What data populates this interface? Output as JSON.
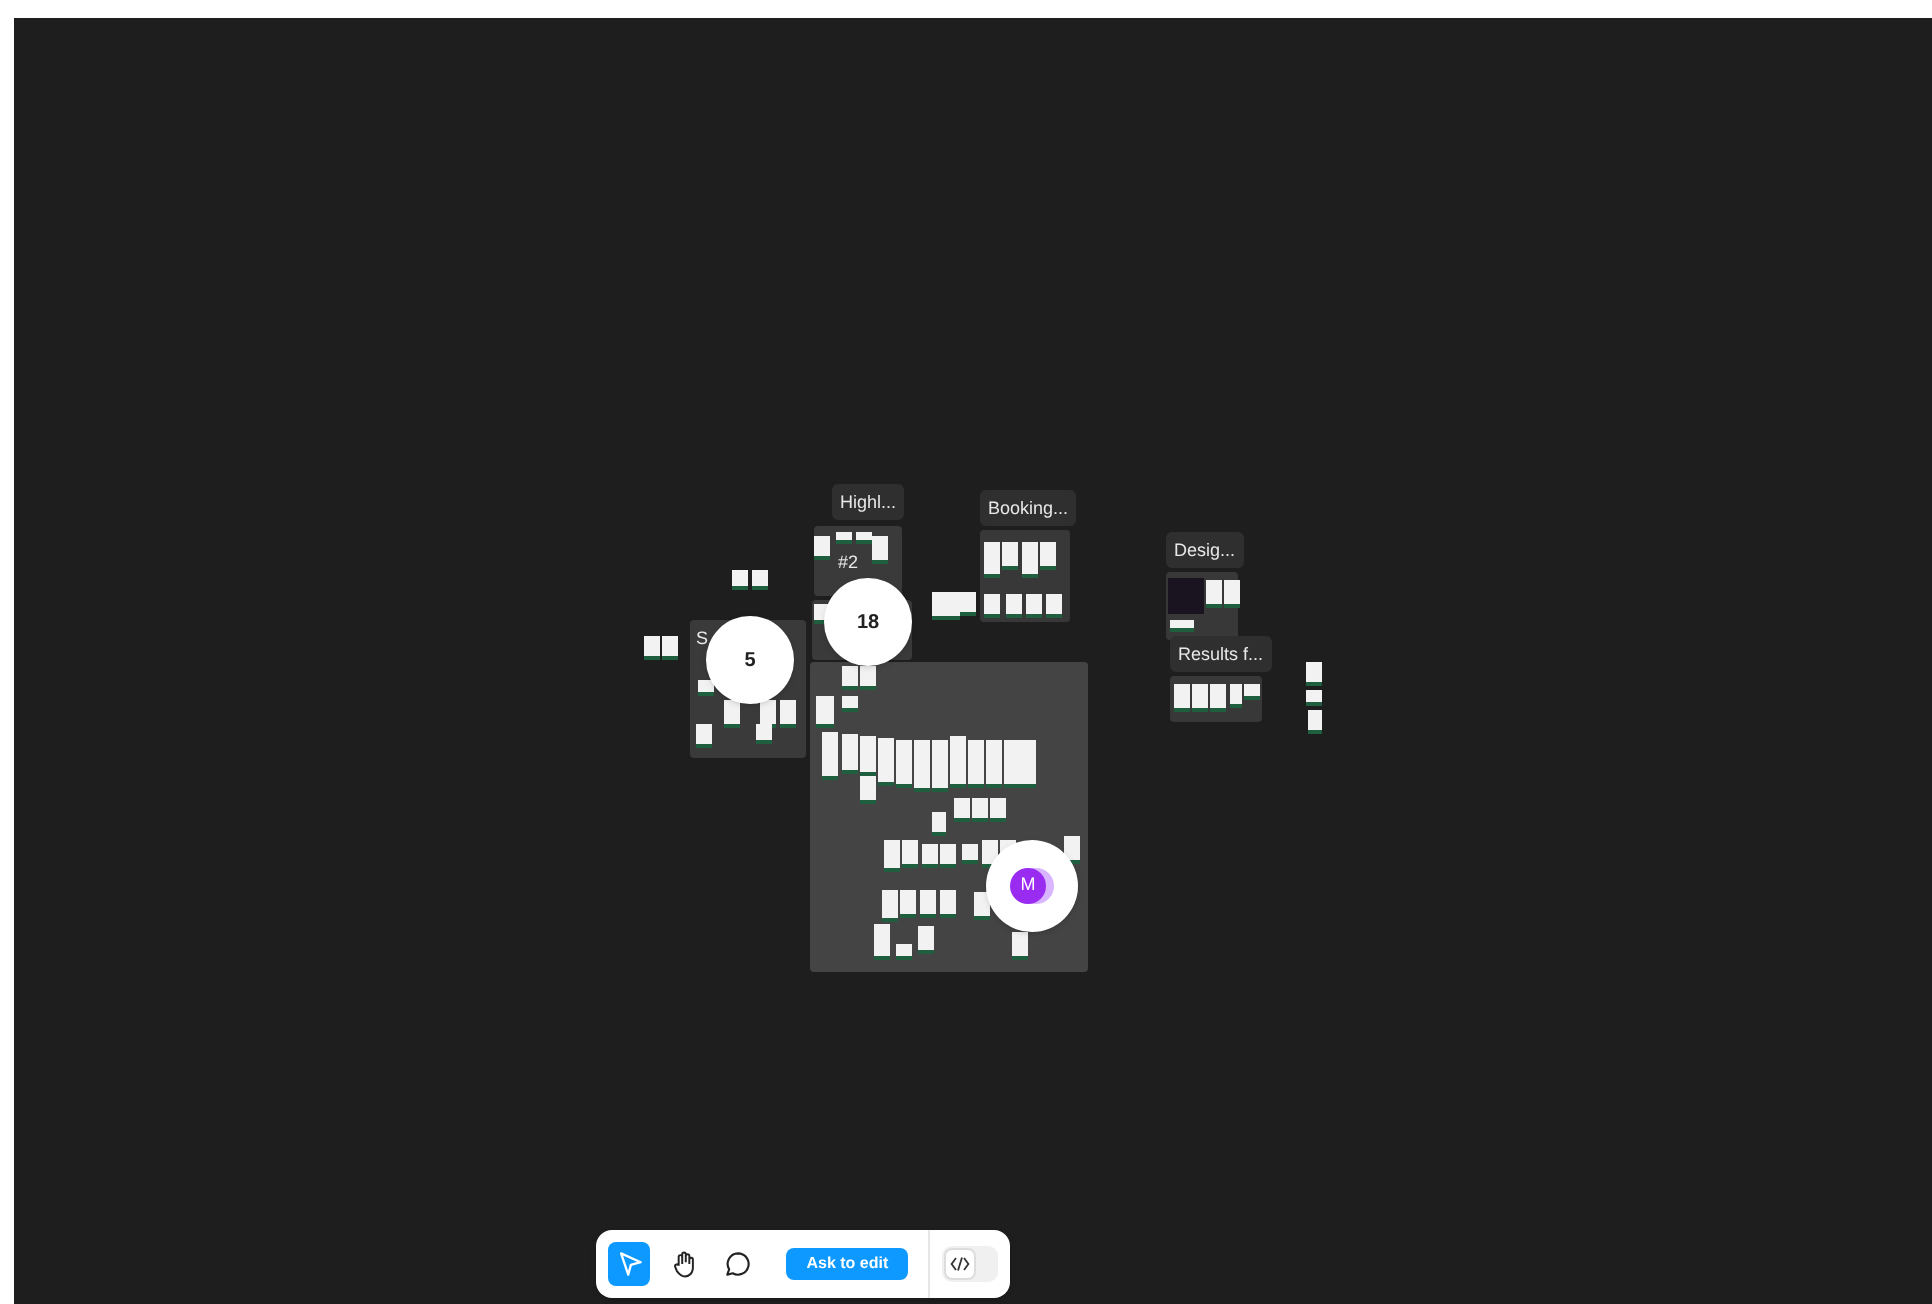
{
  "sections": [
    {
      "label": "Highl..."
    },
    {
      "label": "#2"
    },
    {
      "label": "Booking..."
    },
    {
      "label": "Desig..."
    },
    {
      "label": "Results f..."
    },
    {
      "label": "S"
    }
  ],
  "clusters": [
    {
      "count": "5"
    },
    {
      "count": "18"
    }
  ],
  "collaborator": {
    "initial": "M"
  },
  "toolbar": {
    "tools": [
      {
        "kind": "select",
        "selected": true
      },
      {
        "kind": "hand",
        "selected": false
      },
      {
        "kind": "comment",
        "selected": false
      }
    ],
    "ask_button": "Ask to edit",
    "code_toggle": {
      "on": false
    }
  }
}
